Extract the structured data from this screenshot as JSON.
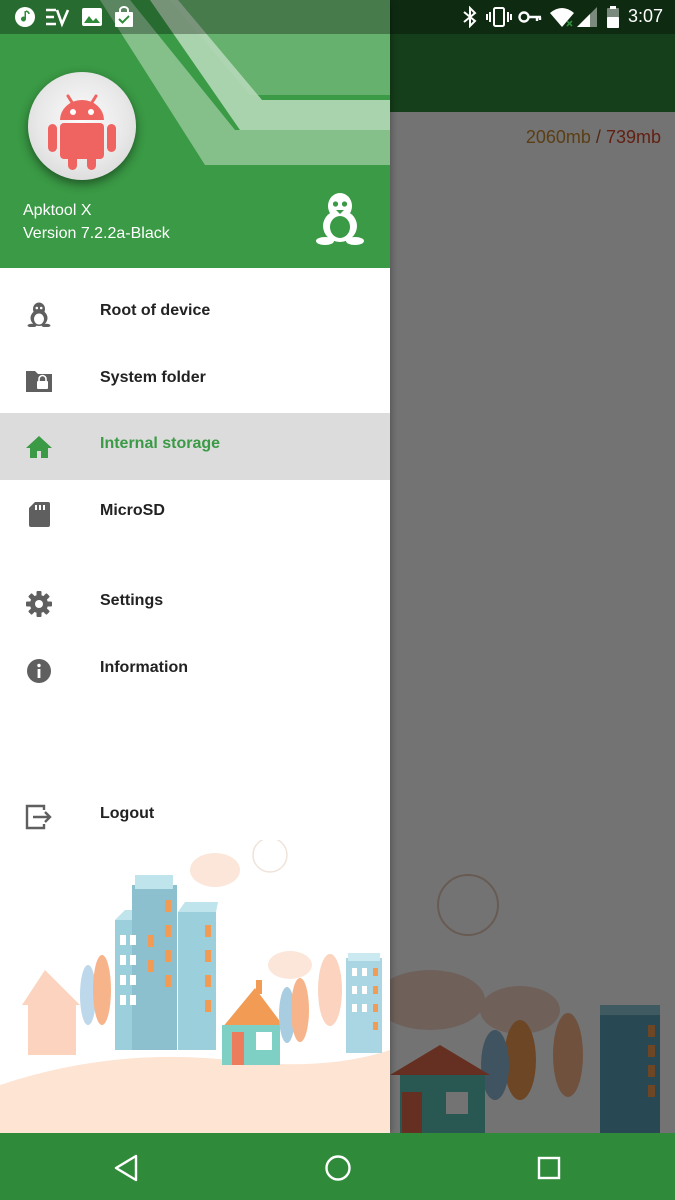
{
  "status_bar": {
    "time": "3:07",
    "left_icons": [
      "music-note-icon",
      "ev-icon",
      "image-icon",
      "shopping-bag-icon"
    ],
    "right_icons": [
      "bluetooth-icon",
      "vibrate-icon",
      "vpn-key-icon",
      "wifi-icon",
      "signal-icon",
      "battery-icon"
    ]
  },
  "background_app": {
    "storage_used": "2060mb",
    "storage_separator": "/",
    "storage_free": "739mb"
  },
  "drawer": {
    "app_name": "Apktool X",
    "version": "Version 7.2.2a-Black",
    "items": [
      {
        "label": "Root of device",
        "icon": "tux-icon",
        "active": false
      },
      {
        "label": "System folder",
        "icon": "locked-folder-icon",
        "active": false
      },
      {
        "label": "Internal storage",
        "icon": "home-icon",
        "active": true
      },
      {
        "label": "MicroSD",
        "icon": "sd-card-icon",
        "active": false
      },
      {
        "label": "Settings",
        "icon": "gear-icon",
        "active": false
      },
      {
        "label": "Information",
        "icon": "info-icon",
        "active": false
      },
      {
        "label": "Logout",
        "icon": "logout-icon",
        "active": false
      }
    ]
  },
  "nav_bar": {
    "buttons": [
      "back-icon",
      "home-circle-icon",
      "recents-icon"
    ]
  },
  "colors": {
    "primary": "#3a9a45",
    "primary_dark": "#2f8b3a",
    "active_row": "#dcdcdc",
    "icon_gray": "#5f5f5f"
  }
}
